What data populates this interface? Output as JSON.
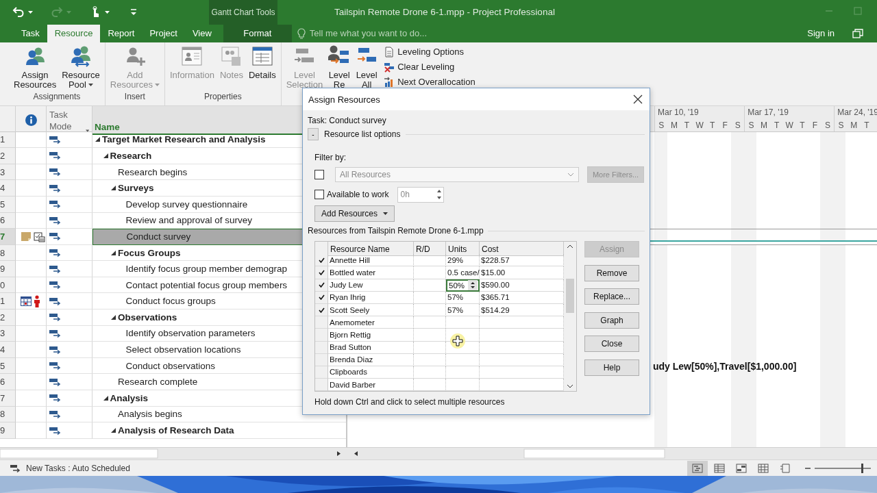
{
  "title_bar": {
    "quick_access": [
      {
        "kind": "undo",
        "disabled": false,
        "dropdown": true
      },
      {
        "kind": "redo",
        "disabled": true,
        "dropdown": true
      },
      {
        "kind": "touch",
        "disabled": false,
        "dropdown": true
      },
      {
        "kind": "customize",
        "disabled": false,
        "dropdown": false
      }
    ],
    "context_group": "Gantt Chart Tools",
    "title": "Tailspin Remote Drone 6-1.mpp - Project Professional"
  },
  "tabs": [
    {
      "label": "Task",
      "selected": false,
      "contextual": false
    },
    {
      "label": "Resource",
      "selected": true,
      "contextual": false
    },
    {
      "label": "Report",
      "selected": false,
      "contextual": false
    },
    {
      "label": "Project",
      "selected": false,
      "contextual": false
    },
    {
      "label": "View",
      "selected": false,
      "contextual": false
    },
    {
      "label": "Format",
      "selected": false,
      "contextual": true
    }
  ],
  "tell_me": {
    "placeholder": "Tell me what you want to do..."
  },
  "sign_in": "Sign in",
  "ribbon": {
    "groups": [
      {
        "label": "Assignments",
        "buttons": [
          {
            "lines": [
              "Assign",
              "Resources"
            ],
            "kind": "assign",
            "disabled": false,
            "dropdown": false
          },
          {
            "lines": [
              "Resource",
              "Pool"
            ],
            "kind": "pool",
            "disabled": false,
            "dropdown": true
          }
        ]
      },
      {
        "label": "Insert",
        "buttons": [
          {
            "lines": [
              "Add",
              "Resources"
            ],
            "kind": "add",
            "disabled": true,
            "dropdown": true
          }
        ]
      },
      {
        "label": "Properties",
        "buttons": [
          {
            "lines": [
              "Information"
            ],
            "kind": "info",
            "disabled": true,
            "dropdown": false
          },
          {
            "lines": [
              "Notes"
            ],
            "kind": "notes",
            "disabled": true,
            "dropdown": false
          },
          {
            "lines": [
              "Details"
            ],
            "kind": "details",
            "disabled": false,
            "dropdown": false
          }
        ]
      },
      {
        "buttons": [
          {
            "lines": [
              "Level",
              "Selection"
            ],
            "kind": "levelselection",
            "disabled": true,
            "dropdown": false
          },
          {
            "lines": [
              "Level",
              "Re"
            ],
            "kind": "levelresource",
            "disabled": false,
            "dropdown": false
          },
          {
            "lines": [
              "Level",
              "All"
            ],
            "kind": "levelall",
            "disabled": false,
            "dropdown": false
          }
        ],
        "small_buttons": [
          {
            "label": "Leveling Options",
            "kind": "options"
          },
          {
            "label": "Clear Leveling",
            "kind": "clear"
          },
          {
            "label": "Next Overallocation",
            "kind": "next"
          }
        ]
      }
    ]
  },
  "table": {
    "headers": [
      "Task Mode",
      "Name"
    ],
    "tasks": [
      {
        "row_number": "1",
        "name": "Target Market Research and Analysis",
        "summary": true,
        "expanded": true,
        "selected": false,
        "children": [
          {
            "row_number": "2",
            "name": "Research",
            "summary": true,
            "expanded": true,
            "selected": false,
            "children": [
              {
                "row_number": "3",
                "name": "Research begins",
                "summary": false,
                "selected": false
              },
              {
                "row_number": "4",
                "name": "Surveys",
                "summary": true,
                "expanded": true,
                "selected": false,
                "children": [
                  {
                    "row_number": "5",
                    "name": "Develop survey questionnaire",
                    "summary": false,
                    "selected": false
                  },
                  {
                    "row_number": "6",
                    "name": "Review and approval of survey",
                    "summary": false,
                    "selected": false
                  },
                  {
                    "row_number": "7",
                    "name": "Conduct survey",
                    "summary": false,
                    "selected": true,
                    "indicators": [
                      {
                        "kind": "note"
                      },
                      {
                        "kind": "assignment"
                      }
                    ]
                  }
                ]
              },
              {
                "row_number": "8",
                "name": "Focus Groups",
                "summary": true,
                "expanded": true,
                "selected": false,
                "children": [
                  {
                    "row_number": "9",
                    "name": "Identify focus group member demograp",
                    "summary": false,
                    "selected": false
                  },
                  {
                    "row_number": "0",
                    "name": "Contact potential focus group members",
                    "summary": false,
                    "selected": false
                  },
                  {
                    "row_number": "1",
                    "name": "Conduct focus groups",
                    "summary": false,
                    "selected": false,
                    "indicators": [
                      {
                        "kind": "calendar"
                      },
                      {
                        "kind": "person"
                      }
                    ]
                  }
                ]
              },
              {
                "row_number": "2",
                "name": "Observations",
                "summary": true,
                "expanded": true,
                "selected": false,
                "children": [
                  {
                    "row_number": "3",
                    "name": "Identify observation parameters",
                    "summary": false,
                    "selected": false
                  },
                  {
                    "row_number": "4",
                    "name": "Select observation locations",
                    "summary": false,
                    "selected": false
                  },
                  {
                    "row_number": "5",
                    "name": "Conduct observations",
                    "summary": false,
                    "selected": false,
                    "gantt_label": "udy Lew[50%],Travel[$1,000.00]"
                  }
                ]
              },
              {
                "row_number": "6",
                "name": "Research complete",
                "summary": false,
                "selected": false
              }
            ]
          },
          {
            "row_number": "7",
            "name": "Analysis",
            "summary": true,
            "expanded": true,
            "selected": false,
            "children": [
              {
                "row_number": "8",
                "name": "Analysis begins",
                "summary": false,
                "selected": false
              },
              {
                "row_number": "9",
                "name": "Analysis of Research Data",
                "summary": true,
                "expanded": true,
                "selected": false
              }
            ]
          }
        ]
      }
    ]
  },
  "gantt": {
    "weeks": [
      {
        "label": "Mar 10, '19",
        "days": [
          "S",
          "M",
          "T",
          "W",
          "T",
          "F",
          "S"
        ]
      },
      {
        "label": "Mar 17, '19",
        "days": [
          "S",
          "M",
          "T",
          "W",
          "T",
          "F",
          "S"
        ]
      },
      {
        "label": "Mar 24, '19",
        "days": [
          "S",
          "M",
          "T"
        ]
      }
    ]
  },
  "dialog": {
    "title": "Assign Resources",
    "task_label": "Task: Conduct survey",
    "options_toggle": "-",
    "options_label": "Resource list options",
    "filter": {
      "label": "Filter by:",
      "checked": false,
      "value": "All Resources",
      "disabled": true,
      "more_button": {
        "label": "More Filters...",
        "disabled": true
      }
    },
    "available": {
      "label": "Available to work",
      "checked": false,
      "value": "0h"
    },
    "add_button": "Add Resources",
    "list_label": "Resources from Tailspin Remote Drone 6-1.mpp",
    "columns": [
      "Resource Name",
      "R/D",
      "Units",
      "Cost"
    ],
    "rows": [
      {
        "checked": true,
        "name": "Annette Hill",
        "units": "29%",
        "cost": "$228.57",
        "editing": false
      },
      {
        "checked": true,
        "name": "Bottled water",
        "units": "0.5 case/",
        "cost": "$15.00",
        "editing": false
      },
      {
        "checked": true,
        "name": "Judy Lew",
        "units": "50%",
        "cost": "$590.00",
        "editing": true
      },
      {
        "checked": true,
        "name": "Ryan Ihrig",
        "units": "57%",
        "cost": "$365.71",
        "editing": false
      },
      {
        "checked": true,
        "name": "Scott Seely",
        "units": "57%",
        "cost": "$514.29",
        "editing": false
      },
      {
        "checked": false,
        "name": "Anemometer",
        "editing": false
      },
      {
        "checked": false,
        "name": "Bjorn Rettig",
        "editing": false
      },
      {
        "checked": false,
        "name": "Brad Sutton",
        "editing": false
      },
      {
        "checked": false,
        "name": "Brenda Diaz",
        "editing": false
      },
      {
        "checked": false,
        "name": "Clipboards",
        "editing": false
      },
      {
        "checked": false,
        "name": "David Barber",
        "editing": false
      }
    ],
    "buttons": [
      {
        "label": "Assign",
        "disabled": true
      },
      {
        "label": "Remove",
        "disabled": false
      },
      {
        "label": "Replace...",
        "disabled": false
      },
      {
        "label": "Graph",
        "disabled": false
      },
      {
        "label": "Close",
        "disabled": false
      },
      {
        "label": "Help",
        "disabled": false
      }
    ],
    "hint": "Hold down Ctrl and click to select multiple resources"
  },
  "status_bar": {
    "text": "New Tasks : Auto Scheduled",
    "views": [
      {
        "kind": "gantt",
        "selected": true
      },
      {
        "kind": "usage",
        "selected": false
      },
      {
        "kind": "planner",
        "selected": false
      },
      {
        "kind": "sheet",
        "selected": false
      },
      {
        "kind": "report",
        "selected": false
      }
    ],
    "zoom": {
      "level": 0.8
    }
  }
}
